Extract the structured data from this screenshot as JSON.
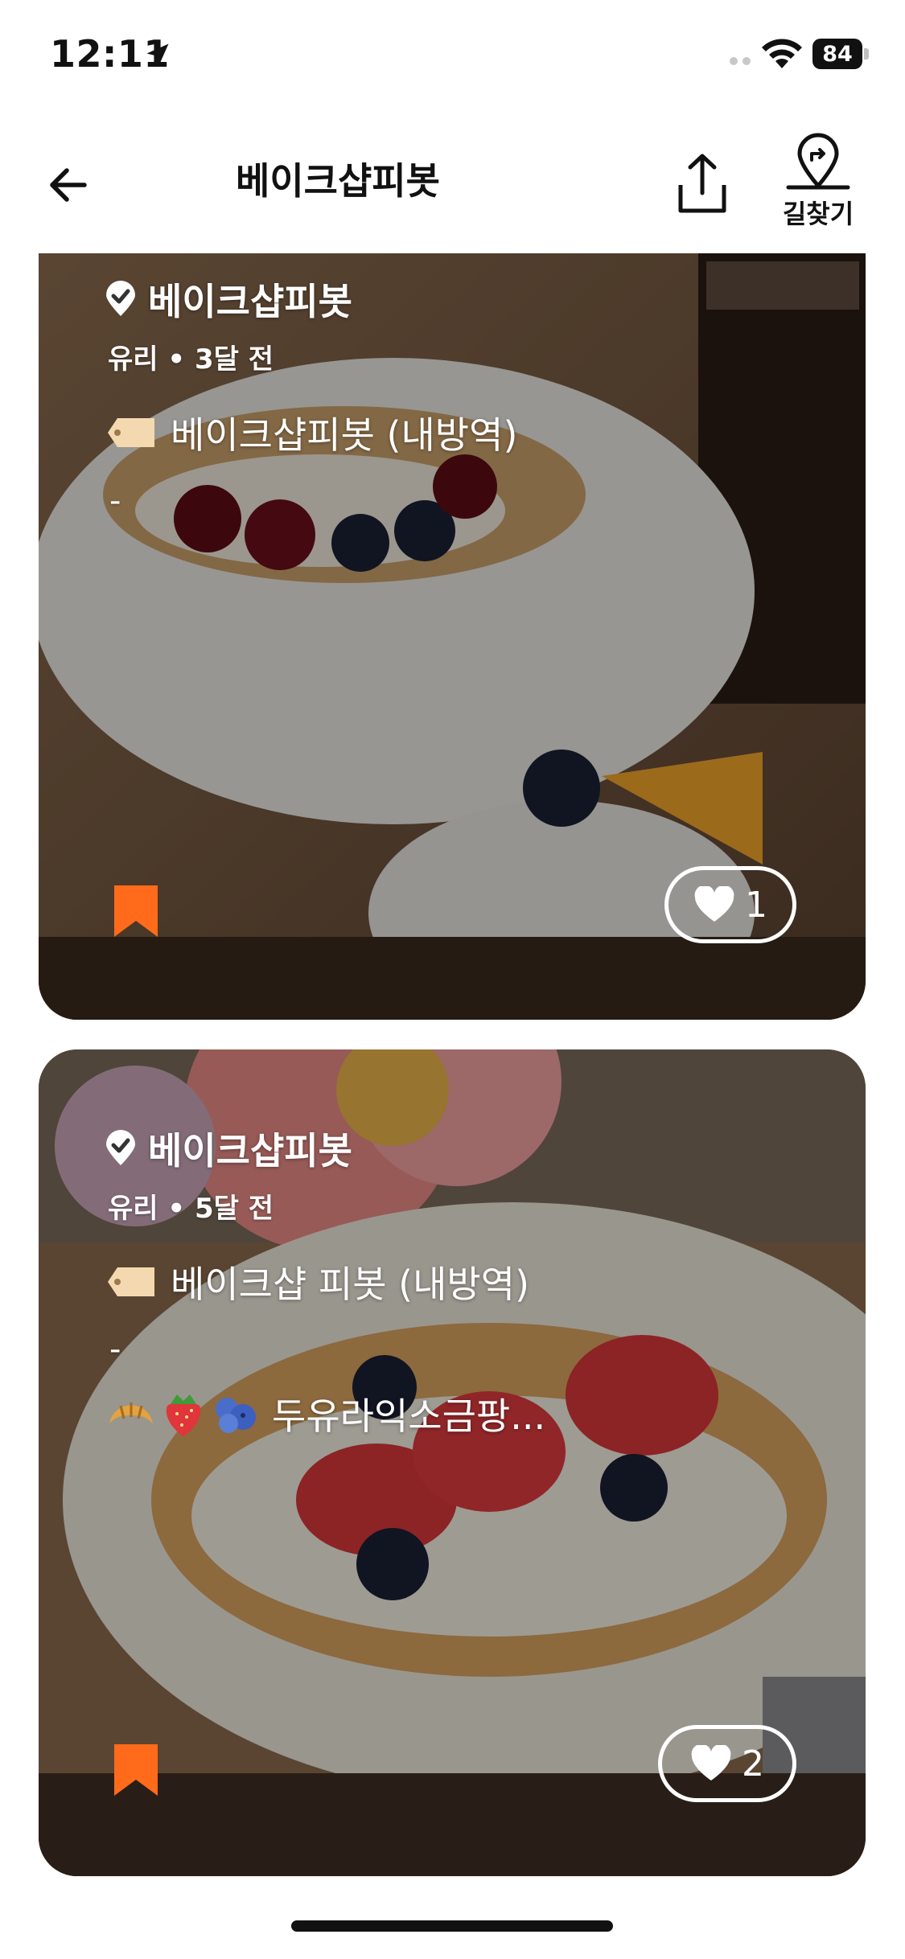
{
  "status_bar": {
    "time": "12:11",
    "battery": "84",
    "icons": [
      "location-arrow-icon",
      "signal-dots-icon",
      "wifi-icon",
      "battery-icon"
    ]
  },
  "header": {
    "title": "베이크샵피봇",
    "directions_label": "길찾기",
    "icons": [
      "back-arrow-icon",
      "share-icon",
      "directions-icon"
    ]
  },
  "posts": [
    {
      "place": "베이크샵피봇",
      "meta": "유리 • 3달 전",
      "tag": "베이크샵피봇 (내방역)",
      "line2": "-",
      "likes": "1"
    },
    {
      "place": "베이크샵피봇",
      "meta": "유리 • 5달 전",
      "tag": "베이크샵 피봇 (내방역)",
      "line2": "-",
      "line3": "두유라익소금팡...",
      "line3_emojis": [
        "croissant",
        "strawberry",
        "blueberries"
      ],
      "likes": "2"
    }
  ],
  "colors": {
    "accent": "#FF6B1A",
    "tag": "#F4D9B0"
  }
}
